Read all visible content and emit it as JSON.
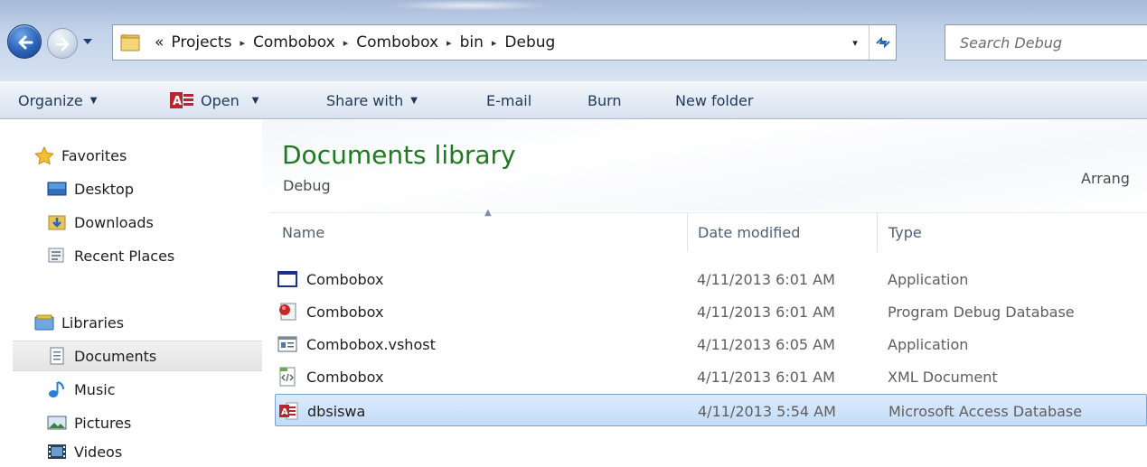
{
  "address_bar": {
    "breadcrumb_overflow": "«",
    "breadcrumbs": [
      "Projects",
      "Combobox",
      "Combobox",
      "bin",
      "Debug"
    ],
    "separator": "▸",
    "dropdown_glyph": "▾",
    "search_placeholder": "Search Debug"
  },
  "command_bar": {
    "organize": "Organize",
    "open": "Open",
    "share_with": "Share with",
    "email": "E-mail",
    "burn": "Burn",
    "new_folder": "New folder",
    "dropdown_glyph": "▼"
  },
  "nav_pane": {
    "favorites": {
      "label": "Favorites",
      "icon": "star-icon"
    },
    "favorite_items": [
      {
        "label": "Desktop",
        "icon": "desktop-icon"
      },
      {
        "label": "Downloads",
        "icon": "downloads-icon"
      },
      {
        "label": "Recent Places",
        "icon": "recent-places-icon"
      }
    ],
    "libraries": {
      "label": "Libraries",
      "icon": "libraries-icon"
    },
    "library_items": [
      {
        "label": "Documents",
        "icon": "documents-icon",
        "selected": true
      },
      {
        "label": "Music",
        "icon": "music-icon"
      },
      {
        "label": "Pictures",
        "icon": "pictures-icon"
      },
      {
        "label": "Videos",
        "icon": "videos-icon"
      }
    ]
  },
  "content": {
    "library_title": "Documents library",
    "library_subtitle": "Debug",
    "arrange_by": "Arrang",
    "columns": {
      "name": "Name",
      "date": "Date modified",
      "type": "Type"
    },
    "files": [
      {
        "name": "Combobox",
        "date": "4/11/2013 6:01 AM",
        "type": "Application",
        "icon": "application-icon"
      },
      {
        "name": "Combobox",
        "date": "4/11/2013 6:01 AM",
        "type": "Program Debug Database",
        "icon": "pdb-icon"
      },
      {
        "name": "Combobox.vshost",
        "date": "4/11/2013 6:05 AM",
        "type": "Application",
        "icon": "vshost-icon"
      },
      {
        "name": "Combobox",
        "date": "4/11/2013 6:01 AM",
        "type": "XML Document",
        "icon": "xml-icon"
      },
      {
        "name": "dbsiswa",
        "date": "4/11/2013 5:54 AM",
        "type": "Microsoft Access Database",
        "icon": "access-db-icon",
        "selected": true
      }
    ]
  },
  "colors": {
    "library_title": "#1e7a1e",
    "command_text": "#1e395b",
    "selection_fill": "#cce1f9",
    "selection_border": "#7da2ce"
  }
}
